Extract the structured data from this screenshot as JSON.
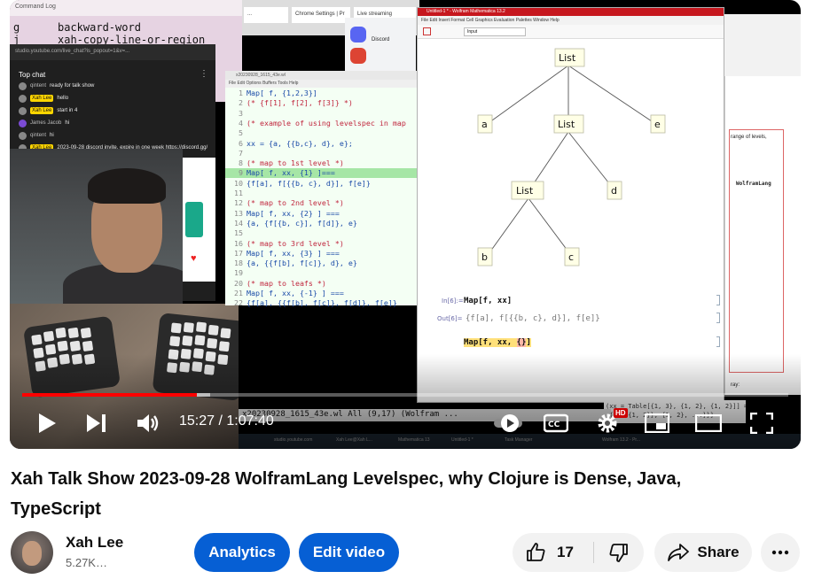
{
  "player": {
    "emacs_title": "Command Log",
    "emacs_lines": [
      {
        "key": "g",
        "cmd": "backward-word"
      },
      {
        "key": "j",
        "cmd": "xah-copy-line-or-region"
      }
    ],
    "browser_tabs": [
      "...",
      "Chrome Settings | Pr",
      "Live streaming",
      "Discord"
    ],
    "chat": {
      "url": "studio.youtube.com/live_chat?is_popout=1&v=...",
      "header": "Top chat",
      "messages": [
        {
          "author": "qintent",
          "text": "ready for talk show",
          "owner": false
        },
        {
          "author": "Xah Lee",
          "text": "hello",
          "owner": true
        },
        {
          "author": "Xah Lee",
          "text": "start in 4",
          "owner": true
        },
        {
          "author": "James Jacob",
          "text": "hi",
          "owner": false
        },
        {
          "author": "qintent",
          "text": "hi",
          "owner": false
        },
        {
          "author": "Xah Lee",
          "text": "2023-09-28 discord invite, expire in one week https://discord.gg/",
          "owner": true
        }
      ]
    },
    "code": {
      "title": "x20230928_1615_43e.wl",
      "menu": "File  Edit  Options  Buffers  Tools  Help",
      "lines": [
        {
          "n": "1",
          "t": "Map[ f, {1,2,3}]",
          "kind": "code",
          "hl": false
        },
        {
          "n": "2",
          "t": "(* {f[1], f[2], f[3]} *)",
          "kind": "comment",
          "hl": false
        },
        {
          "n": "3",
          "t": "",
          "kind": "code",
          "hl": false
        },
        {
          "n": "4",
          "t": "(* example of using levelspec in map",
          "kind": "comment",
          "hl": false
        },
        {
          "n": "5",
          "t": "",
          "kind": "code",
          "hl": false
        },
        {
          "n": "6",
          "t": "xx = {a, {{b,c}, d}, e};",
          "kind": "code",
          "hl": false
        },
        {
          "n": "7",
          "t": "",
          "kind": "code",
          "hl": false
        },
        {
          "n": "8",
          "t": "(* map to 1st level *)",
          "kind": "comment",
          "hl": false
        },
        {
          "n": "9",
          "t": "Map[ f, xx, {1} ]===",
          "kind": "code",
          "hl": true
        },
        {
          "n": "10",
          "t": "{f[a], f[{{b, c}, d}], f[e]}",
          "kind": "code",
          "hl": false
        },
        {
          "n": "11",
          "t": "",
          "kind": "code",
          "hl": false
        },
        {
          "n": "12",
          "t": "(* map to 2nd level *)",
          "kind": "comment",
          "hl": false
        },
        {
          "n": "13",
          "t": "Map[ f, xx, {2} ] ===",
          "kind": "code",
          "hl": false
        },
        {
          "n": "14",
          "t": "{a, {f[{b, c}], f[d]}, e}",
          "kind": "code",
          "hl": false
        },
        {
          "n": "15",
          "t": "",
          "kind": "code",
          "hl": false
        },
        {
          "n": "16",
          "t": "(* map to 3rd level *)",
          "kind": "comment",
          "hl": false
        },
        {
          "n": "17",
          "t": "Map[ f, xx, {3} ] ===",
          "kind": "code",
          "hl": false
        },
        {
          "n": "18",
          "t": "{a, {{f[b], f[c]}, d}, e}",
          "kind": "code",
          "hl": false
        },
        {
          "n": "19",
          "t": "",
          "kind": "code",
          "hl": false
        },
        {
          "n": "20",
          "t": "(* map to leafs *)",
          "kind": "comment",
          "hl": false
        },
        {
          "n": "21",
          "t": "Map[ f, xx, {-1} ] ===",
          "kind": "code",
          "hl": false
        },
        {
          "n": "22",
          "t": "{f[a], {{f[b], f[c]}, f[d]}, f[e]}",
          "kind": "code",
          "hl": false
        }
      ]
    },
    "mathematica": {
      "title": "Untitled-1 * - Wolfram Mathematica 13.2",
      "menu": "File  Edit  Insert  Format  Cell  Graphics  Evaluation  Palettes  Window  Help",
      "input_style": "Input",
      "tree": {
        "root": "List",
        "l1_a": "a",
        "l1_list": "List",
        "l1_e": "e",
        "l2_list": "List",
        "l2_d": "d",
        "l3_b": "b",
        "l3_c": "c"
      },
      "in_label": "In[6]:=",
      "in_code": "Map[f, xx]",
      "out_label": "Out[6]=",
      "out_code": "{f[a], f[{{b, c}, d}], f[e]}",
      "next_code_prefix": "Map[f, xx, ",
      "next_code_braces": "{}",
      "next_code_suffix": "]"
    },
    "right_windows": {
      "text1": "range of levels,",
      "text2": "WolframLang",
      "text3": "ray:"
    },
    "modeline": "x20230928_1615_43e.wl  All (9,17)  (Wolfram ...",
    "bottom_code_lines": [
      "(xx = Table[{1, 3}, {1, 2}, {1, 2}]] ===",
      "{{{1, {1, 2}}, {1, 2}, ...}}}"
    ],
    "taskbar_items": [
      "studio.youtube.com",
      "Xah Lee@Xah L...",
      "Mathematica 13",
      "Untitled-1 *",
      "Task Manager",
      "Wolfram 13.2 - Pr..."
    ],
    "controls": {
      "time_current": "15:27",
      "time_total": "1:07:40",
      "progress_played": 0.2282,
      "progress_buffered": 0.2455,
      "hd_label": "HD"
    }
  },
  "video": {
    "title": "Xah Talk Show 2023-09-28 WolframLang Levelspec, why Clojure is Dense, Java, TypeScript",
    "channel_name": "Xah Lee",
    "subscribers": "5.27K…",
    "analytics_label": "Analytics",
    "edit_label": "Edit video",
    "like_count": "17",
    "share_label": "Share"
  }
}
